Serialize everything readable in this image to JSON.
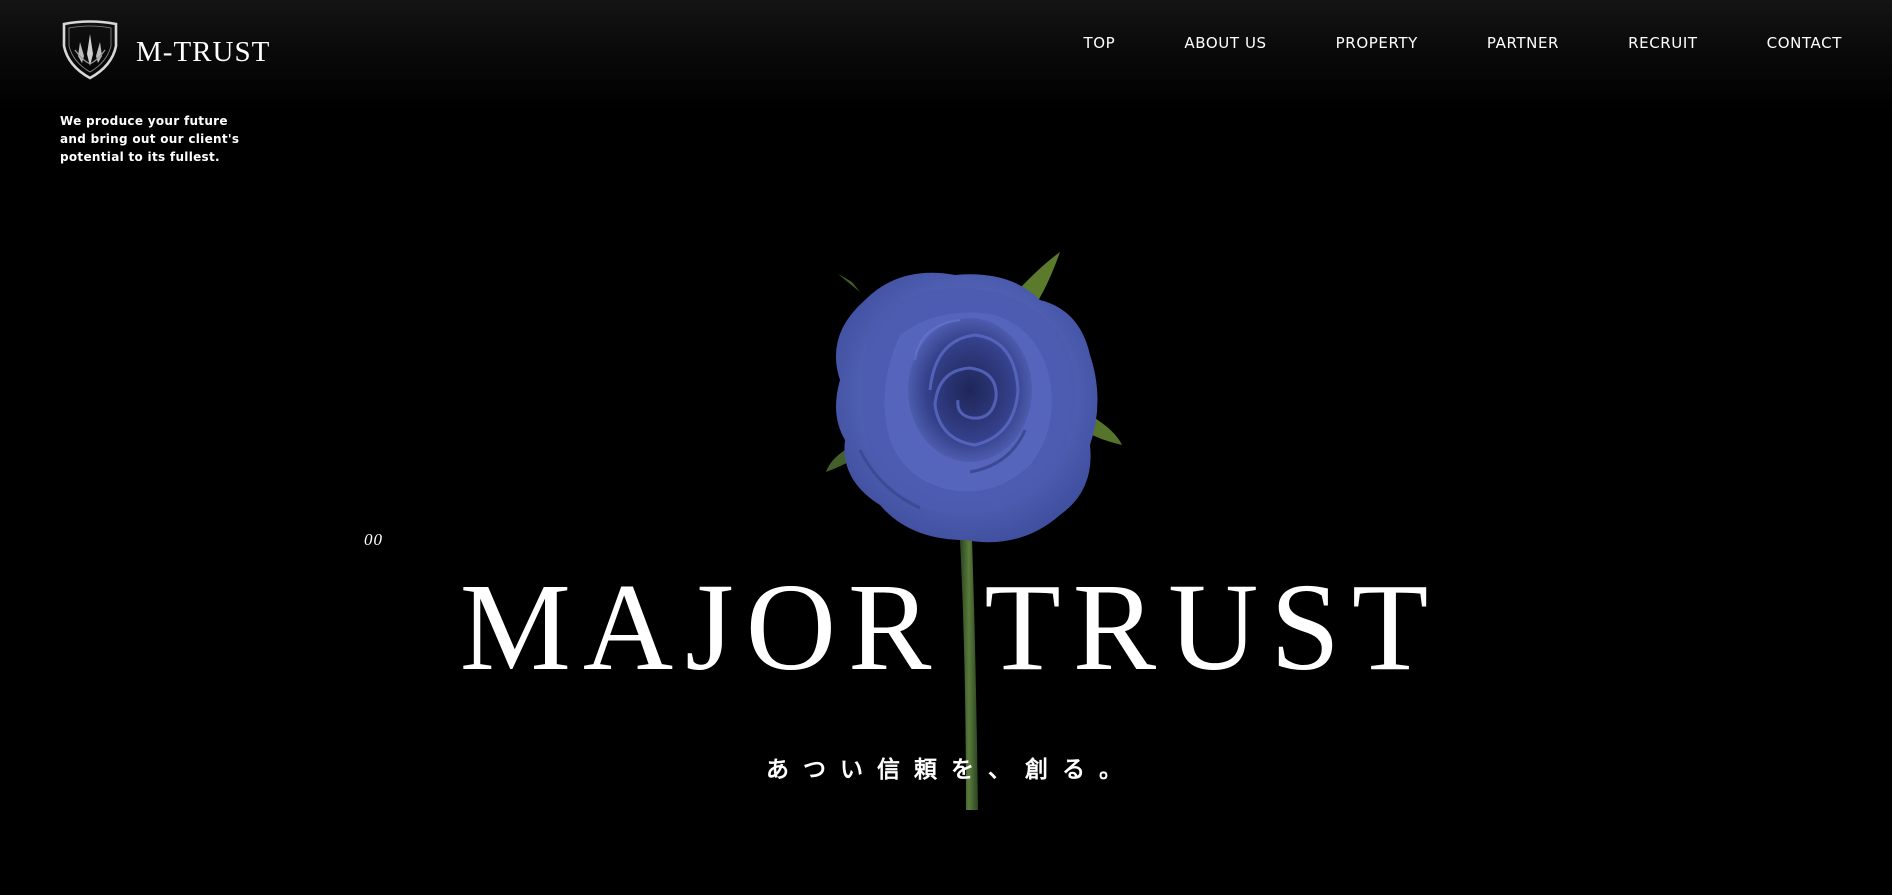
{
  "header": {
    "logo_text": "M-TRUST",
    "logo_icon": "shield-emblem-icon",
    "nav": [
      {
        "label": "TOP"
      },
      {
        "label": "ABOUT US"
      },
      {
        "label": "PROPERTY"
      },
      {
        "label": "PARTNER"
      },
      {
        "label": "RECRUIT"
      },
      {
        "label": "CONTACT"
      }
    ]
  },
  "tagline": "We produce your future and bring out our client's potential to its fullest.",
  "hero": {
    "index": "00",
    "title": "MAJOR TRUST",
    "subtitle": "あつい信頼を、創る。",
    "image": "blue-rose-image"
  },
  "colors": {
    "background": "#000000",
    "text": "#ffffff",
    "rose": "#4a5bb0",
    "stem": "#3c5a2a"
  }
}
